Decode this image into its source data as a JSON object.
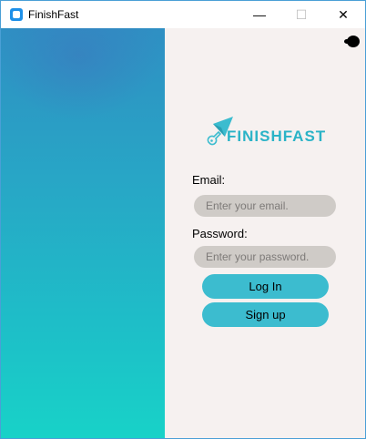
{
  "window": {
    "title": "FinishFast",
    "minimize_glyph": "—",
    "maximize_glyph": "☐",
    "close_glyph": "✕"
  },
  "logo": {
    "text": "FINISHFAST",
    "icon": "paper-plane-guitar-icon",
    "color": "#2ab3c7"
  },
  "form": {
    "email_label": "Email:",
    "email_placeholder": "Enter your email.",
    "email_value": "",
    "password_label": "Password:",
    "password_placeholder": "Enter your password.",
    "password_value": "",
    "login_label": "Log In",
    "signup_label": "Sign up"
  },
  "colors": {
    "accent": "#3cbccf",
    "panel_bg": "#f6f1f0",
    "gradient_top": "#2f8fc3",
    "gradient_bottom": "#18d2c8"
  }
}
